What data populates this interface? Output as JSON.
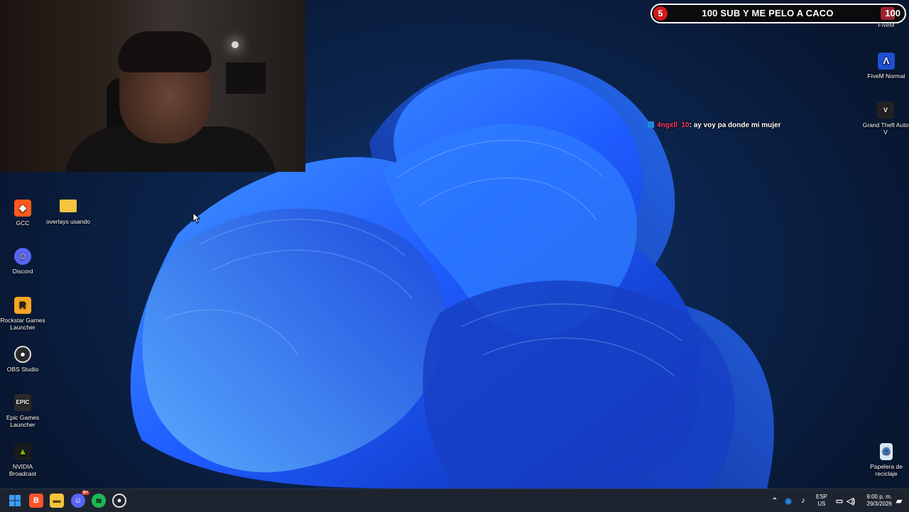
{
  "webcam": {
    "label": ""
  },
  "banner": {
    "count": "5",
    "title": "100 SUB Y ME PELO A CACO",
    "goal": "100"
  },
  "chat": {
    "user": "4ngxll_10",
    "message": ": ay voy pa donde mi mujer"
  },
  "desktop_icons_left": [
    {
      "label": "GCC",
      "icon": "gcc-icon"
    },
    {
      "label": "overlays usando",
      "icon": "folder-icon"
    },
    {
      "label": "Discord",
      "icon": "discord-icon"
    },
    {
      "label": "Rockstar Games Launcher",
      "icon": "rockstar-icon"
    },
    {
      "label": "OBS Studio",
      "icon": "obs-icon"
    },
    {
      "label": "Epic Games Launcher",
      "icon": "epic-icon"
    },
    {
      "label": "NVIDIA Broadcast",
      "icon": "nvidia-icon"
    }
  ],
  "desktop_icons_right": [
    {
      "label": "FiveM",
      "icon": "fivem-icon"
    },
    {
      "label": "FiveM Normal",
      "icon": "fivem-normal-icon"
    },
    {
      "label": "Grand Theft Auto V",
      "icon": "gta-icon"
    },
    {
      "label": "Papelera de reciclaje",
      "icon": "recycle-bin-icon"
    }
  ],
  "taskbar": {
    "apps": [
      "start",
      "brave",
      "file-explorer",
      "discord",
      "spotify",
      "obs"
    ],
    "discord_badge": "9+",
    "tray": {
      "lang": "ESP",
      "region": "US",
      "time": "9:00 p. m.",
      "date": "29/3/2026"
    }
  },
  "colors": {
    "accent": "#1e6bff",
    "banner_red": "#d11a1a",
    "chat_user": "#ff3b6b"
  }
}
